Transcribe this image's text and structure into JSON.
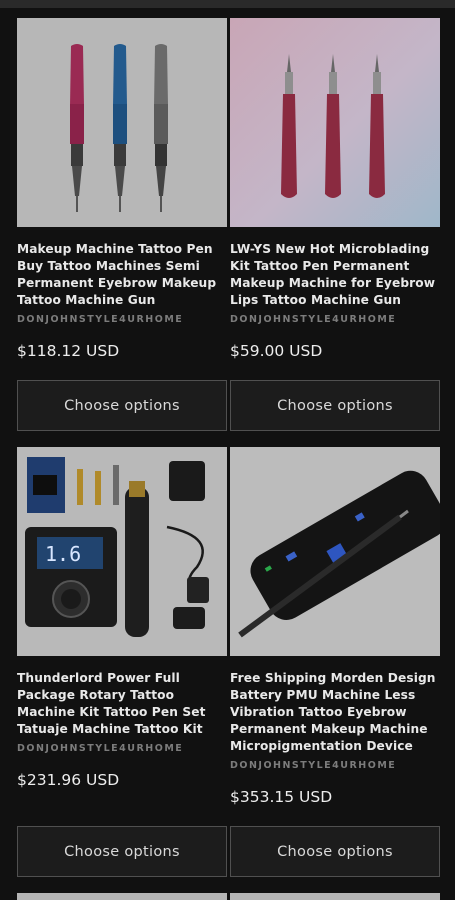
{
  "products": [
    {
      "title": "Makeup Machine Tattoo Pen Buy Tattoo Machines Semi Permanent Eyebrow Makeup Tattoo Machine Gun",
      "vendor": "DONJOHNSTYLE4URHOME",
      "price": "$118.12 USD",
      "button": "Choose options"
    },
    {
      "title": "LW-YS New Hot Microblading Kit Tattoo Pen Permanent Makeup Machine for Eyebrow Lips Tattoo Machine Gun",
      "vendor": "DONJOHNSTYLE4URHOME",
      "price": "$59.00 USD",
      "button": "Choose options"
    },
    {
      "title": "Thunderlord Power Full Package Rotary Tattoo Machine Kit Tattoo Pen Set Tatuaje Machine Tattoo Kit",
      "vendor": "DONJOHNSTYLE4URHOME",
      "price": "$231.96 USD",
      "button": "Choose options",
      "screen_text": "1.6"
    },
    {
      "title": "Free Shipping Morden Design Battery PMU Machine Less Vibration Tattoo Eyebrow Permanent Makeup Machine Micropigmentation Device",
      "vendor": "DONJOHNSTYLE4URHOME",
      "price": "$353.15 USD",
      "button": "Choose options"
    }
  ],
  "colors": {
    "background": "#111111",
    "button_border": "#505050",
    "vendor_text": "#7c7c7c"
  }
}
